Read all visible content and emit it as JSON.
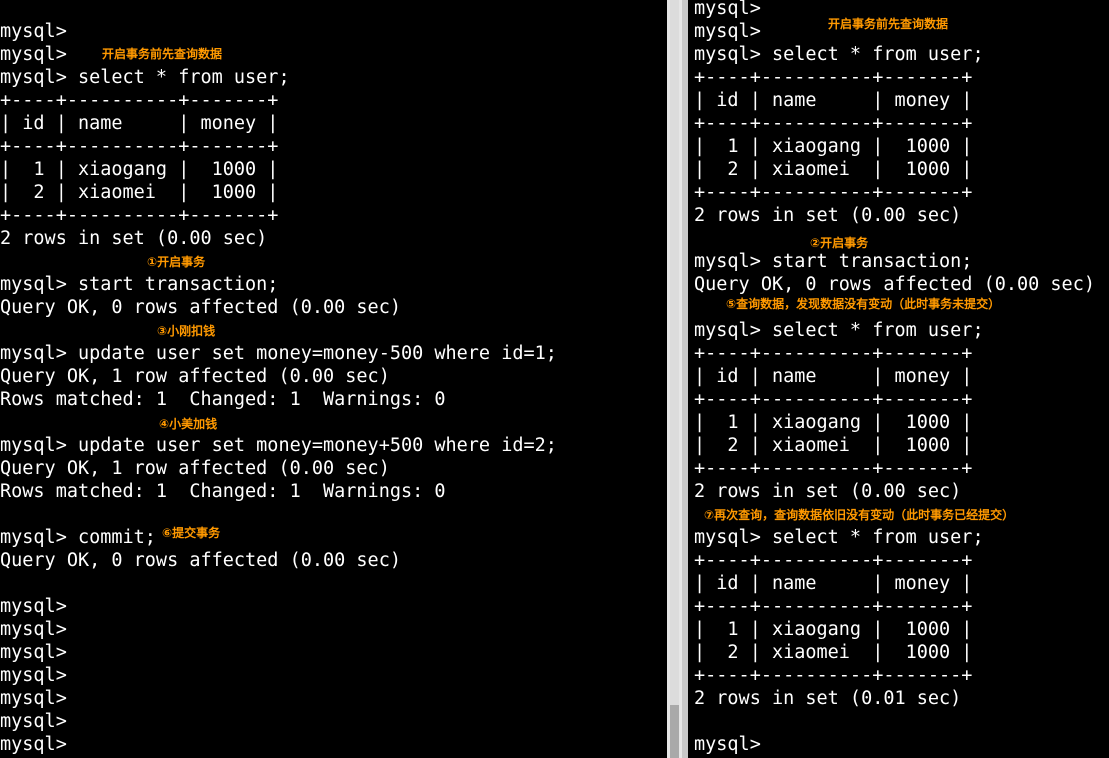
{
  "left_terminal": {
    "lines": [
      "mysql>",
      "mysql>",
      "mysql> select * from user;",
      "+----+----------+-------+",
      "| id | name     | money |",
      "+----+----------+-------+",
      "|  1 | xiaogang |  1000 |",
      "|  2 | xiaomei  |  1000 |",
      "+----+----------+-------+",
      "2 rows in set (0.00 sec)",
      "",
      "mysql> start transaction;",
      "Query OK, 0 rows affected (0.00 sec)",
      "",
      "mysql> update user set money=money-500 where id=1;",
      "Query OK, 1 row affected (0.00 sec)",
      "Rows matched: 1  Changed: 1  Warnings: 0",
      "",
      "mysql> update user set money=money+500 where id=2;",
      "Query OK, 1 row affected (0.00 sec)",
      "Rows matched: 1  Changed: 1  Warnings: 0",
      "",
      "mysql> commit;",
      "Query OK, 0 rows affected (0.00 sec)",
      "",
      "mysql>",
      "mysql>",
      "mysql>",
      "mysql>",
      "mysql>",
      "mysql>",
      "mysql>"
    ],
    "annotations": [
      "开启事务前先查询数据",
      "①开启事务",
      "③小刚扣钱",
      "④小美加钱",
      "⑥提交事务"
    ]
  },
  "right_terminal": {
    "lines": [
      "mysql>",
      "mysql>",
      "mysql> select * from user;",
      "+----+----------+-------+",
      "| id | name     | money |",
      "+----+----------+-------+",
      "|  1 | xiaogang |  1000 |",
      "|  2 | xiaomei  |  1000 |",
      "+----+----------+-------+",
      "2 rows in set (0.00 sec)",
      "",
      "mysql> start transaction;",
      "Query OK, 0 rows affected (0.00 sec)",
      "",
      "mysql> select * from user;",
      "+----+----------+-------+",
      "| id | name     | money |",
      "+----+----------+-------+",
      "|  1 | xiaogang |  1000 |",
      "|  2 | xiaomei  |  1000 |",
      "+----+----------+-------+",
      "2 rows in set (0.00 sec)",
      "",
      "mysql> select * from user;",
      "+----+----------+-------+",
      "| id | name     | money |",
      "+----+----------+-------+",
      "|  1 | xiaogang |  1000 |",
      "|  2 | xiaomei  |  1000 |",
      "+----+----------+-------+",
      "2 rows in set (0.01 sec)",
      "",
      "mysql>"
    ],
    "annotations": [
      "开启事务前先查询数据",
      "②开启事务",
      "⑤查询数据，发现数据没有变动（此时事务未提交）",
      "⑦再次查询，查询数据依旧没有变动（此时事务已经提交）"
    ]
  },
  "colors": {
    "background": "#000000",
    "text": "#ffffff",
    "annotation": "#ff9900",
    "scrollbar_track": "#dcdcdc",
    "scrollbar_thumb": "#a9a9a9"
  }
}
